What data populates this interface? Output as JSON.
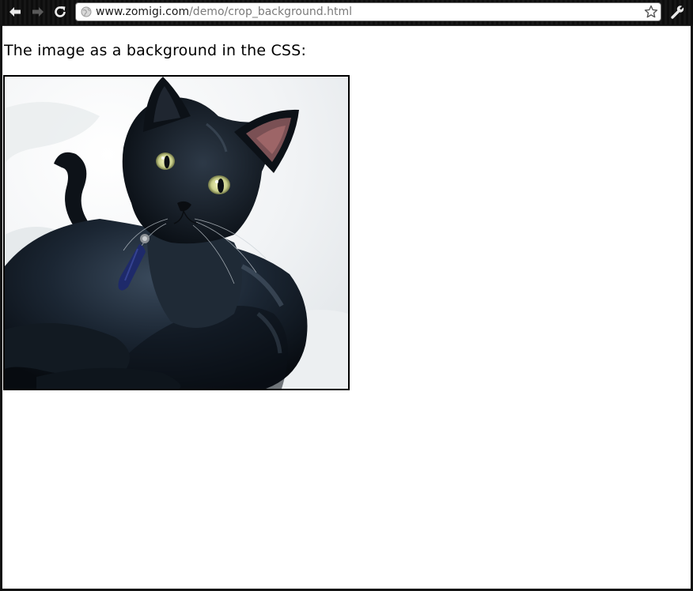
{
  "browser": {
    "back_icon": "arrow-left-icon",
    "forward_icon": "arrow-right-icon",
    "reload_icon": "reload-icon",
    "url_domain": "www.zomigi.com",
    "url_path": "/demo/crop_background.html",
    "bookmark_icon": "star-icon",
    "settings_icon": "wrench-icon"
  },
  "page": {
    "caption": "The image as a background in the CSS:",
    "image_alt": "black cat photo"
  }
}
